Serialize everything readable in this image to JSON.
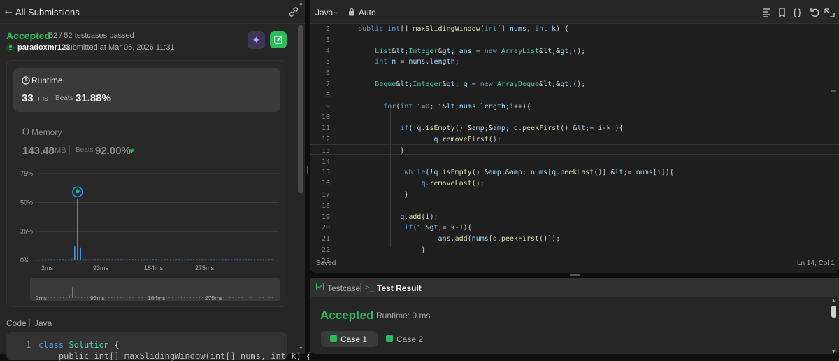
{
  "left": {
    "back_label": "All Submissions",
    "status": "Accepted",
    "testcases_passed": "52 / 52 testcases passed",
    "username": "paradoxmr123",
    "submitted_at": "submitted at Mar 06, 2026 11:31",
    "runtime": {
      "label": "Runtime",
      "value": "33",
      "unit": "ms",
      "beats_label": "Beats",
      "beats": "31.88%"
    },
    "memory": {
      "label": "Memory",
      "value": "143.48",
      "unit": "MB",
      "beats_label": "Beats",
      "beats": "92.00%"
    },
    "code_label": "Code",
    "code_lang": "Java",
    "code_preview": {
      "line1_num": "1",
      "line1": "class Solution {",
      "line2": "    public int[] maxSlidingWindow(int[] nums, int k) {"
    }
  },
  "chart_data": {
    "type": "bar",
    "ylabel_ticks": [
      "75%",
      "50%",
      "25%",
      "0%"
    ],
    "ylim": [
      0,
      75
    ],
    "x_ticks": [
      "2ms",
      "93ms",
      "184ms",
      "275ms"
    ],
    "series": [
      {
        "values": [
          0.8,
          0.8,
          0.8,
          0.8,
          0.8,
          0.8,
          0.8,
          0.8,
          0.8,
          0.8,
          0.8,
          12,
          53,
          11,
          0.8,
          0.8,
          0.8,
          0.8,
          0.8,
          0.8,
          0.8,
          0.8,
          0.8,
          0.8,
          0.8,
          0.8,
          0.8,
          0.8,
          0.8,
          0.8,
          0.8,
          0.8,
          0.8,
          0.8,
          0.8,
          0.8,
          0.8,
          0.8,
          0.8,
          0.8,
          0.8,
          0.8,
          0.8,
          0.8,
          0.8,
          0.8,
          0.8,
          0.8,
          0.8,
          0.8,
          0.8,
          0.8,
          0.8,
          0.8,
          0.8,
          0.8,
          0.8,
          0.8,
          0.8,
          0.8,
          0.8,
          0.8,
          0.8,
          0.8,
          0.8,
          0.8,
          0.8,
          0.8,
          0.8,
          0.8,
          0.8,
          0.8,
          0.8,
          0.8,
          0.8,
          0.8,
          0.8,
          0.8,
          0.8,
          0.8
        ]
      }
    ],
    "highlight_index": 12,
    "bar_color": "#3a90e8",
    "mini_ticks": [
      "2ms",
      "93ms",
      "184ms",
      "275ms"
    ]
  },
  "editor": {
    "language": "Java",
    "mode": "Auto",
    "saved": "Saved",
    "cursor": "Ln 14, Col 1",
    "lines": [
      {
        "n": "2",
        "t": "    public int[] maxSlidingWindow(int[] nums, int k) {"
      },
      {
        "n": "3",
        "t": ""
      },
      {
        "n": "4",
        "t": "        List<Integer> ans = new ArrayList<>();"
      },
      {
        "n": "5",
        "t": "        int n = nums.length;"
      },
      {
        "n": "6",
        "t": ""
      },
      {
        "n": "7",
        "t": "        Deque<Integer> q = new ArrayDeque<>();"
      },
      {
        "n": "8",
        "t": ""
      },
      {
        "n": "9",
        "t": "          for(int i=0; i<nums.length;i++){"
      },
      {
        "n": "10",
        "t": ""
      },
      {
        "n": "11",
        "t": "              if(!q.isEmpty() && q.peekFirst() <= i-k ){"
      },
      {
        "n": "12",
        "t": "                      q.removeFirst();"
      },
      {
        "n": "13",
        "t": "              }"
      },
      {
        "n": "14",
        "t": ""
      },
      {
        "n": "15",
        "t": "               while(!q.isEmpty() && nums[q.peekLast()] <= nums[i]){"
      },
      {
        "n": "16",
        "t": "                   q.removeLast();"
      },
      {
        "n": "17",
        "t": "               }"
      },
      {
        "n": "18",
        "t": ""
      },
      {
        "n": "19",
        "t": "              q.add(i);"
      },
      {
        "n": "20",
        "t": "               if(i >= k-1){"
      },
      {
        "n": "21",
        "t": "                       ans.add(nums[q.peekFirst()]);"
      },
      {
        "n": "22",
        "t": "                   }"
      },
      {
        "n": "23",
        "t": ""
      }
    ]
  },
  "bottom": {
    "tab_testcase": "Testcase",
    "tab_result": "Test Result",
    "result_status": "Accepted",
    "result_runtime": "Runtime: 0 ms",
    "case1": "Case 1",
    "case2": "Case 2"
  },
  "colors": {
    "accent_green": "#2cbb5d",
    "bar_blue": "#3a90e8",
    "panel": "#262626"
  }
}
